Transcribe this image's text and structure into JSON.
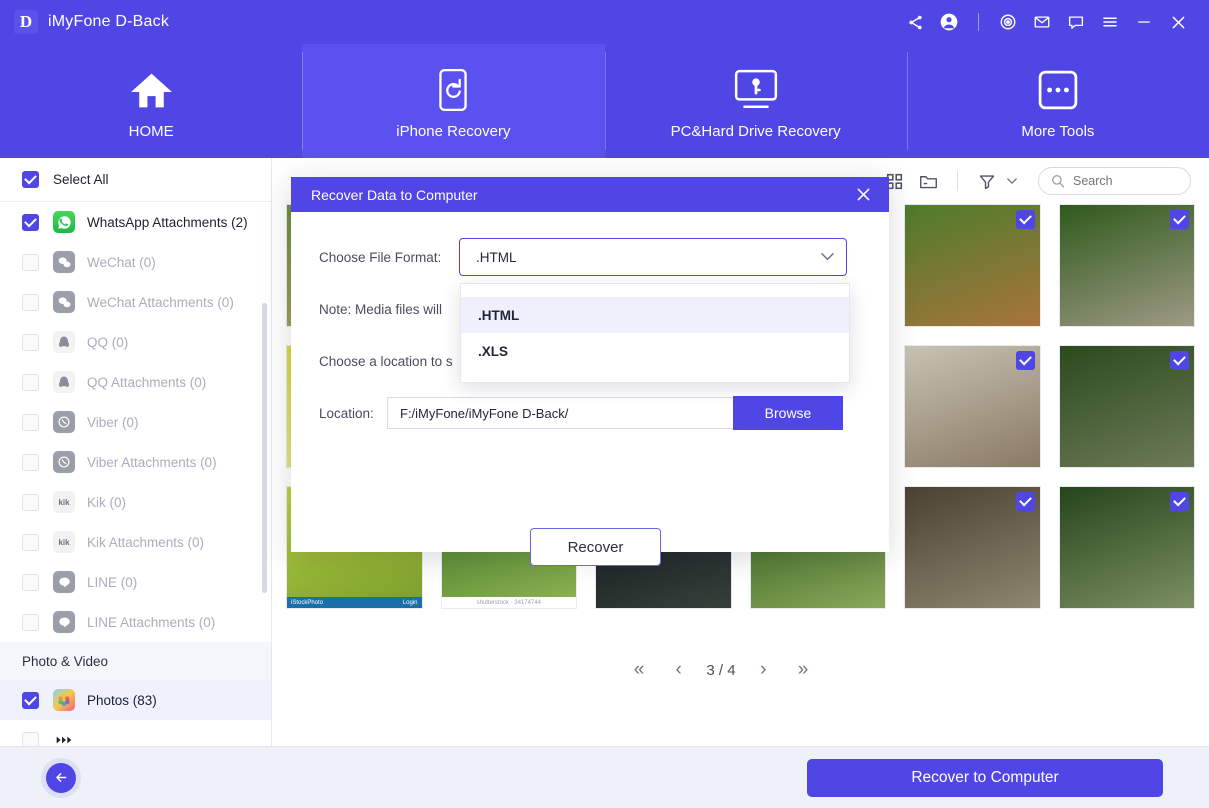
{
  "titlebar": {
    "logo_letter": "D",
    "app_title": "iMyFone D-Back",
    "icons": [
      {
        "name": "share-icon",
        "glyph": "share"
      },
      {
        "name": "account-icon",
        "glyph": "account"
      },
      {
        "name": "target-icon",
        "glyph": "target"
      },
      {
        "name": "mail-icon",
        "glyph": "mail"
      },
      {
        "name": "chat-icon",
        "glyph": "chat"
      },
      {
        "name": "menu-icon",
        "glyph": "menu"
      },
      {
        "name": "minimize-icon",
        "glyph": "minimize"
      },
      {
        "name": "close-icon",
        "glyph": "close"
      }
    ]
  },
  "nav": {
    "tabs": [
      {
        "label": "HOME",
        "icon": "home-icon"
      },
      {
        "label": "iPhone Recovery",
        "icon": "phone-refresh-icon"
      },
      {
        "label": "PC&Hard Drive Recovery",
        "icon": "monitor-key-icon"
      },
      {
        "label": "More Tools",
        "icon": "more-dots-icon"
      }
    ]
  },
  "sidebar": {
    "select_all_label": "Select All",
    "select_all_checked": true,
    "items": [
      {
        "label": "WhatsApp Attachments (2)",
        "checked": true,
        "enabled": true,
        "icon": "whatsapp-icon",
        "color": "#25d366"
      },
      {
        "label": "WeChat (0)",
        "checked": false,
        "enabled": false,
        "icon": "wechat-icon",
        "color": "#9a9ea9"
      },
      {
        "label": "WeChat Attachments (0)",
        "checked": false,
        "enabled": false,
        "icon": "wechat-icon",
        "color": "#9a9ea9"
      },
      {
        "label": "QQ (0)",
        "checked": false,
        "enabled": false,
        "icon": "qq-icon",
        "color": "#f2f2f2"
      },
      {
        "label": "QQ Attachments (0)",
        "checked": false,
        "enabled": false,
        "icon": "qq-icon",
        "color": "#f2f2f2"
      },
      {
        "label": "Viber (0)",
        "checked": false,
        "enabled": false,
        "icon": "viber-icon",
        "color": "#9a9ea9"
      },
      {
        "label": "Viber Attachments (0)",
        "checked": false,
        "enabled": false,
        "icon": "viber-icon",
        "color": "#9a9ea9"
      },
      {
        "label": "Kik (0)",
        "checked": false,
        "enabled": false,
        "icon": "kik-icon",
        "color": "#f2f2f2"
      },
      {
        "label": "Kik Attachments (0)",
        "checked": false,
        "enabled": false,
        "icon": "kik-icon",
        "color": "#f2f2f2"
      },
      {
        "label": "LINE (0)",
        "checked": false,
        "enabled": false,
        "icon": "line-icon",
        "color": "#9a9ea9"
      },
      {
        "label": "LINE Attachments (0)",
        "checked": false,
        "enabled": false,
        "icon": "line-icon",
        "color": "#9a9ea9"
      }
    ],
    "group_header": "Photo & Video",
    "group_items": [
      {
        "label": "Photos (83)",
        "checked": true,
        "enabled": true,
        "icon": "photos-icon",
        "selected": true
      }
    ]
  },
  "toolbar": {
    "icons": [
      {
        "name": "grid-view-icon"
      },
      {
        "name": "folder-view-icon"
      },
      {
        "name": "filter-icon"
      }
    ],
    "search_placeholder": "Search",
    "search_value": ""
  },
  "pager": {
    "first_label": "«",
    "prev_label": "‹",
    "page_text": "3 / 4",
    "next_label": "›",
    "last_label": "»"
  },
  "bottombar": {
    "back_label": "←",
    "recover_label": "Recover to Computer"
  },
  "modal": {
    "title": "Recover Data to Computer",
    "close_label": "✕",
    "format_label": "Choose File Format:",
    "format_value": ".HTML",
    "note_text": "Note: Media files will",
    "location_prompt": "Choose a location to s",
    "location_label": "Location:",
    "location_value": "F:/iMyFone/iMyFone D-Back/",
    "browse_label": "Browse",
    "recover_label": "Recover",
    "dropdown_options": [
      {
        "label": ".HTML",
        "highlighted": true
      },
      {
        "label": ".XLS",
        "highlighted": false
      }
    ]
  },
  "photos": {
    "cells": [
      {
        "checked": true,
        "g1": "#6d8f3a",
        "g2": "#b6a263",
        "caption_left": "",
        "caption_right": ""
      },
      {
        "checked": true,
        "g1": "#cfd3d6",
        "g2": "#e4e6e8",
        "caption_left": "",
        "caption_right": ""
      },
      {
        "checked": true,
        "g1": "#3c6b22",
        "g2": "#95a85c",
        "caption_left": "",
        "caption_right": ""
      },
      {
        "checked": true,
        "g1": "#7e9b4b",
        "g2": "#c0b276",
        "caption_left": "",
        "caption_right": ""
      },
      {
        "checked": true,
        "g1": "#4d7c2a",
        "g2": "#a8743c",
        "caption_left": "",
        "caption_right": ""
      },
      {
        "checked": true,
        "g1": "#2f5a1c",
        "g2": "#9e9a84",
        "caption_left": "",
        "caption_right": ""
      },
      {
        "checked": true,
        "g1": "#d9d83f",
        "g2": "#e8e49a",
        "caption_left": "",
        "caption_right": ""
      },
      {
        "checked": true,
        "g1": "#e9ecef",
        "g2": "#f5f6f7",
        "caption_left": "",
        "caption_right": ""
      },
      {
        "checked": true,
        "g1": "#151a20",
        "g2": "#3e4a3a",
        "caption_left": "",
        "caption_right": ""
      },
      {
        "checked": true,
        "g1": "#355c1d",
        "g2": "#7f9a4e",
        "caption_left": "",
        "caption_right": ""
      },
      {
        "checked": true,
        "g1": "#c8c3b4",
        "g2": "#8a7a63",
        "caption_left": "",
        "caption_right": ""
      },
      {
        "checked": true,
        "g1": "#2b4a1c",
        "g2": "#6d7a59",
        "caption_left": "",
        "caption_right": ""
      },
      {
        "checked": true,
        "g1": "#b9d640",
        "g2": "#7a9c2d",
        "caption_left": "iStockPhoto",
        "caption_right": "Login"
      },
      {
        "checked": true,
        "g1": "#3f7a22",
        "g2": "#8fb355",
        "caption_left": "",
        "caption_right": "shutterstock · 34174744"
      },
      {
        "checked": true,
        "g1": "#0e1318",
        "g2": "#36403a",
        "caption_left": "",
        "caption_right": ""
      },
      {
        "checked": true,
        "g1": "#2d5a1b",
        "g2": "#8aa85a",
        "caption_left": "",
        "caption_right": ""
      },
      {
        "checked": true,
        "g1": "#4a4132",
        "g2": "#8f8670",
        "caption_left": "",
        "caption_right": ""
      },
      {
        "checked": true,
        "g1": "#26451a",
        "g2": "#7c8f63",
        "caption_left": "",
        "caption_right": ""
      }
    ]
  }
}
